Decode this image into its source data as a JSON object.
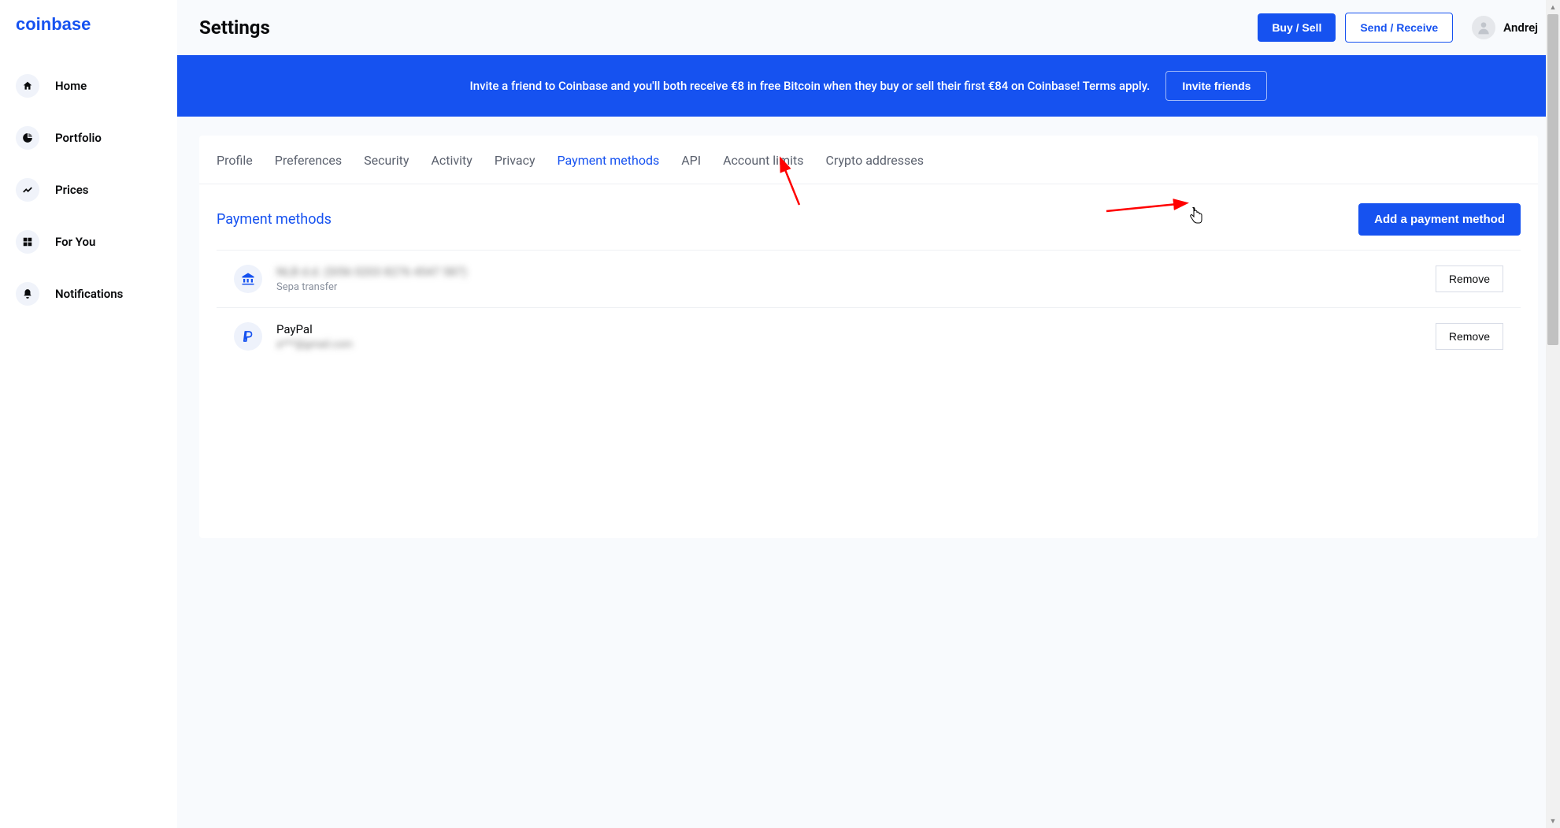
{
  "brand": "coinbase",
  "sidebar": {
    "items": [
      {
        "label": "Home",
        "icon": "home"
      },
      {
        "label": "Portfolio",
        "icon": "pie"
      },
      {
        "label": "Prices",
        "icon": "chart"
      },
      {
        "label": "For You",
        "icon": "grid"
      },
      {
        "label": "Notifications",
        "icon": "bell"
      }
    ]
  },
  "header": {
    "title": "Settings",
    "buy_sell": "Buy / Sell",
    "send_receive": "Send / Receive",
    "user_name": "Andrej"
  },
  "banner": {
    "text": "Invite a friend to Coinbase and you'll both receive €8 in free Bitcoin when they buy or sell their first €84 on Coinbase! Terms apply.",
    "cta": "Invite friends"
  },
  "tabs": [
    {
      "label": "Profile",
      "active": false
    },
    {
      "label": "Preferences",
      "active": false
    },
    {
      "label": "Security",
      "active": false
    },
    {
      "label": "Activity",
      "active": false
    },
    {
      "label": "Privacy",
      "active": false
    },
    {
      "label": "Payment methods",
      "active": true
    },
    {
      "label": "API",
      "active": false
    },
    {
      "label": "Account limits",
      "active": false
    },
    {
      "label": "Crypto addresses",
      "active": false
    }
  ],
  "section": {
    "title": "Payment methods",
    "add_button": "Add a payment method"
  },
  "methods": [
    {
      "name_blurred": "NLB d.d. (SI56 0203 8276 4547 587)",
      "sub": "Sepa transfer",
      "icon": "bank",
      "remove": "Remove"
    },
    {
      "name": "PayPal",
      "sub_blurred": "a***@gmail.com",
      "icon": "paypal",
      "remove": "Remove"
    }
  ]
}
